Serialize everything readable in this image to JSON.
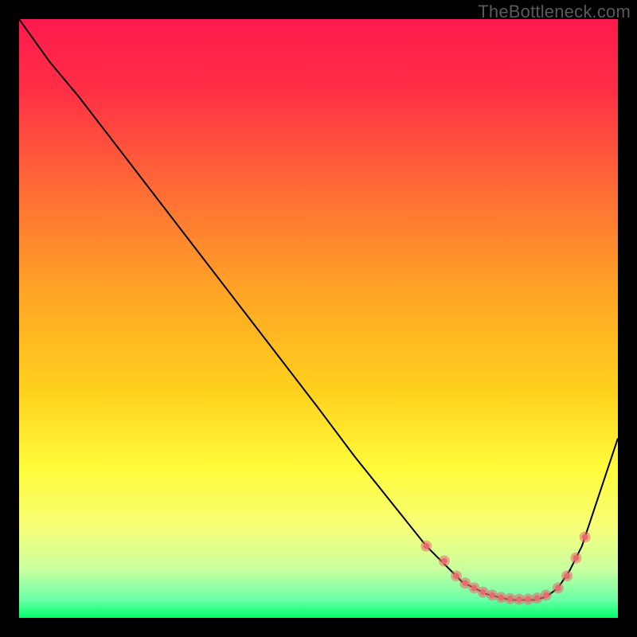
{
  "watermark": "TheBottleneck.com",
  "chart_data": {
    "type": "line",
    "title": "",
    "xlabel": "",
    "ylabel": "",
    "xlim": [
      0,
      100
    ],
    "ylim": [
      0,
      100
    ],
    "grid": false,
    "legend": false,
    "background_gradient": {
      "colors_top_to_bottom": [
        "#ff1a4d",
        "#ff5a3a",
        "#ff9a2a",
        "#ffd61f",
        "#ffff4a",
        "#d9ff8a",
        "#00ff66"
      ]
    },
    "series": [
      {
        "name": "curve",
        "x": [
          0,
          5,
          10,
          20,
          30,
          40,
          50,
          56,
          60,
          64,
          68,
          70,
          72,
          74,
          76,
          78,
          80,
          82,
          84,
          86,
          88,
          90,
          92,
          94,
          96,
          98,
          100
        ],
        "y": [
          100,
          93,
          87,
          74,
          61,
          48,
          35,
          27,
          22,
          17,
          12,
          10,
          8,
          6,
          5,
          4,
          3.5,
          3,
          3,
          3,
          3.5,
          5,
          8,
          12,
          18,
          24,
          30
        ],
        "line_color": "#000000",
        "line_width": 2
      }
    ],
    "annotation_points": {
      "name": "highlight-dots",
      "color": "#e86a6f",
      "radius_outer": 7,
      "radius_inner": 3.8,
      "coords": [
        [
          68,
          12
        ],
        [
          71,
          9.5
        ],
        [
          73,
          7
        ],
        [
          74.5,
          5.8
        ],
        [
          76,
          5
        ],
        [
          77.5,
          4.3
        ],
        [
          79,
          3.8
        ],
        [
          80.5,
          3.4
        ],
        [
          82,
          3.2
        ],
        [
          83.5,
          3.1
        ],
        [
          85,
          3.1
        ],
        [
          86.5,
          3.3
        ],
        [
          88,
          3.8
        ],
        [
          90,
          5
        ],
        [
          91.5,
          7
        ],
        [
          93,
          10
        ],
        [
          94.5,
          13.5
        ]
      ]
    }
  }
}
